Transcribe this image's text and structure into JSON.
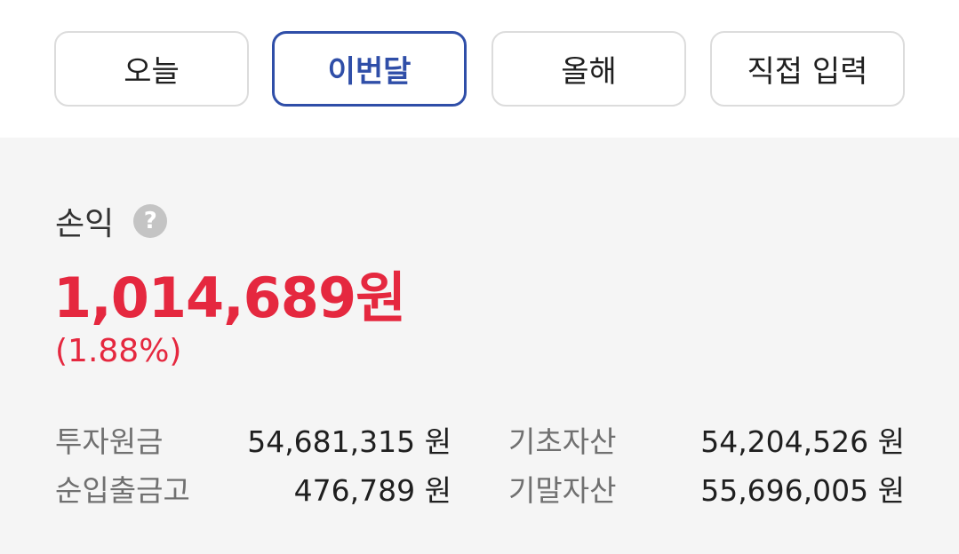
{
  "period_tabs": [
    {
      "label": "오늘",
      "active": false
    },
    {
      "label": "이번달",
      "active": true
    },
    {
      "label": "올해",
      "active": false
    },
    {
      "label": "직접 입력",
      "active": false
    }
  ],
  "profit": {
    "label": "손익",
    "help_icon": "?",
    "amount": "1,014,689원",
    "rate": "(1.88%)"
  },
  "stats": [
    {
      "label": "투자원금",
      "value": "54,681,315 원"
    },
    {
      "label": "순입출금고",
      "value": "476,789 원"
    },
    {
      "label": "기초자산",
      "value": "54,204,526 원"
    },
    {
      "label": "기말자산",
      "value": "55,696,005 원"
    }
  ],
  "colors": {
    "accent": "#2f4ea8",
    "profit_red": "#e5283f",
    "panel_bg": "#f5f5f5"
  }
}
